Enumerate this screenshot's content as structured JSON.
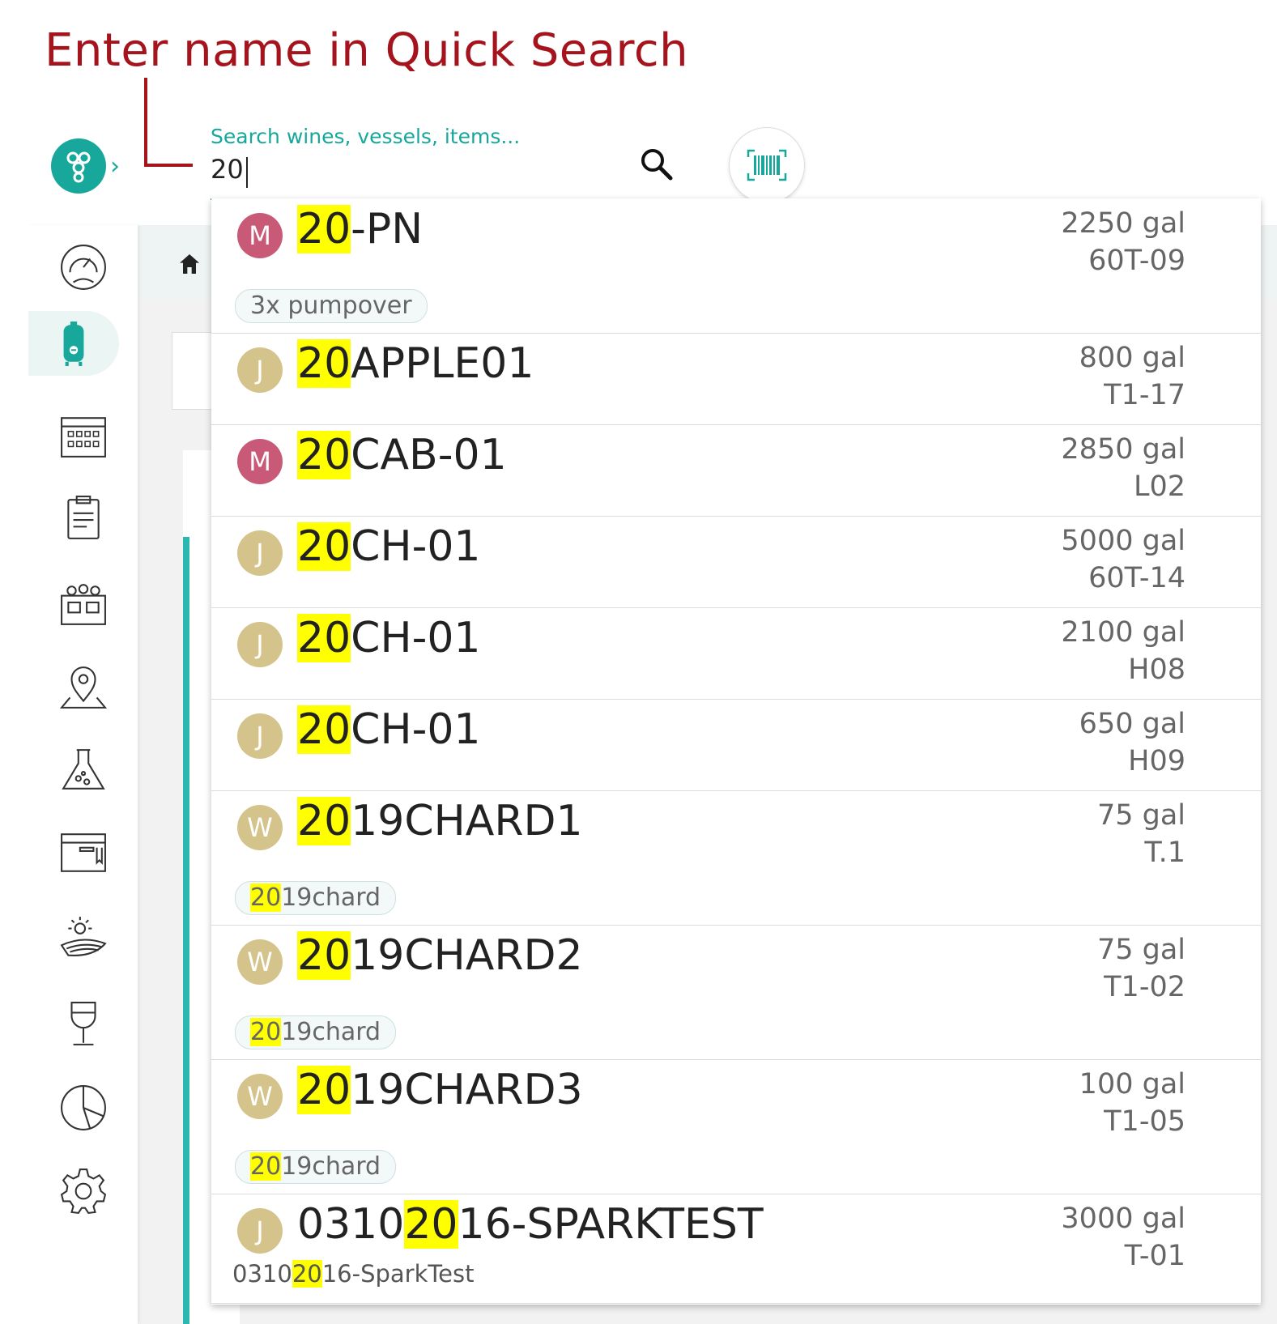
{
  "annotation": {
    "title": "Enter name in Quick Search"
  },
  "search": {
    "label": "Search wines, vessels, items...",
    "value": "20"
  },
  "colors": {
    "accent": "#17a89b",
    "annotation": "#a5141d",
    "highlight": "#ffff00"
  },
  "sidebar": {
    "items": [
      {
        "icon": "dashboard-gauge-icon"
      },
      {
        "icon": "vessel-tank-icon",
        "active": true
      },
      {
        "icon": "calendar-icon"
      },
      {
        "icon": "clipboard-icon"
      },
      {
        "icon": "barrel-rack-icon"
      },
      {
        "icon": "map-pin-icon"
      },
      {
        "icon": "lab-flask-icon"
      },
      {
        "icon": "storage-box-icon"
      },
      {
        "icon": "vineyard-sun-icon"
      },
      {
        "icon": "wine-glass-icon"
      },
      {
        "icon": "reports-pie-icon"
      },
      {
        "icon": "settings-gear-icon"
      }
    ]
  },
  "results": [
    {
      "badge": "M",
      "pre": "",
      "hl": "20",
      "post": "-PN",
      "volume": "2250 gal",
      "vessel": "60T-09",
      "tag": {
        "pre": "",
        "hl": "",
        "post": "3x pumpover"
      }
    },
    {
      "badge": "J",
      "pre": "",
      "hl": "20",
      "post": "APPLE01",
      "volume": "800 gal",
      "vessel": "T1-17"
    },
    {
      "badge": "M",
      "pre": "",
      "hl": "20",
      "post": "CAB-01",
      "volume": "2850 gal",
      "vessel": "L02"
    },
    {
      "badge": "J",
      "pre": "",
      "hl": "20",
      "post": "CH-01",
      "volume": "5000 gal",
      "vessel": "60T-14"
    },
    {
      "badge": "J",
      "pre": "",
      "hl": "20",
      "post": "CH-01",
      "volume": "2100 gal",
      "vessel": "H08"
    },
    {
      "badge": "J",
      "pre": "",
      "hl": "20",
      "post": "CH-01",
      "volume": "650 gal",
      "vessel": "H09"
    },
    {
      "badge": "W",
      "pre": "",
      "hl": "20",
      "post": "19CHARD1",
      "volume": "75 gal",
      "vessel": "T.1",
      "tag": {
        "pre": "",
        "hl": "20",
        "post": "19chard"
      }
    },
    {
      "badge": "W",
      "pre": "",
      "hl": "20",
      "post": "19CHARD2",
      "volume": "75 gal",
      "vessel": "T1-02",
      "tag": {
        "pre": "",
        "hl": "20",
        "post": "19chard"
      }
    },
    {
      "badge": "W",
      "pre": "",
      "hl": "20",
      "post": "19CHARD3",
      "volume": "100 gal",
      "vessel": "T1-05",
      "tag": {
        "pre": "",
        "hl": "20",
        "post": "19chard"
      }
    },
    {
      "badge": "J",
      "pre": "0310",
      "hl": "20",
      "post": "16-SPARKTEST",
      "volume": "3000 gal",
      "vessel": "T-01",
      "sub": {
        "pre": "0310",
        "hl": "20",
        "post": "16-SparkTest"
      }
    }
  ]
}
